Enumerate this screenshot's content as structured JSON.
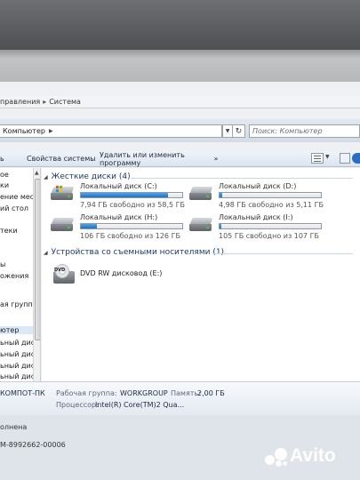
{
  "breadcrumb": {
    "part1": "правления",
    "part2": "Система"
  },
  "address": {
    "path": "Компьютер",
    "search_placeholder": "Поиск: Компьютер"
  },
  "toolbar": {
    "left_fragment": "ь",
    "system_properties": "Свойства системы",
    "uninstall": "Удалить или изменить программу",
    "more": "»"
  },
  "nav": {
    "items": [
      "ое",
      "ки",
      "ение места",
      "ий стол",
      "",
      "теки",
      "",
      "",
      "ы",
      "ожения",
      "",
      "",
      "ая группа",
      "",
      "ютер",
      "ьный диск",
      "ьный диск",
      "ьный диск",
      "ьный диск"
    ]
  },
  "hdd_group": {
    "title": "Жесткие диски (4)"
  },
  "drives": [
    {
      "name": "Локальный диск (C:)",
      "free": "7,94 ГБ свободно из 58,5 ГБ",
      "used_fraction": 0.86
    },
    {
      "name": "Локальный диск (D:)",
      "free": "4,98 ГБ свободно из 5,11 ГБ",
      "used_fraction": 0.03
    },
    {
      "name": "Локальный диск (H:)",
      "free": "106 ГБ свободно из 126 ГБ",
      "used_fraction": 0.16
    },
    {
      "name": "Локальный диск (I:)",
      "free": "105 ГБ свободно из 107 ГБ",
      "used_fraction": 0.02
    }
  ],
  "removable_group": {
    "title": "Устройства со съемными носителями (1)"
  },
  "dvd": {
    "name": "DVD RW дисковод (E:)",
    "badge": "DVD"
  },
  "details": {
    "pc_name": "КОМПОТ-ПК",
    "workgroup_label": "Рабочая группа:",
    "workgroup_value": "WORKGROUP",
    "memory_label": "Память:",
    "memory_value": "2,00 ГБ",
    "cpu_label": "Процессор:",
    "cpu_value": "Intel(R) Core(TM)2 Qua..."
  },
  "status": {
    "activation": "олнена",
    "product_id": "M-8992662-00006"
  },
  "watermark": {
    "brand": "Avito"
  },
  "colors": {
    "bar_fill": "#1d6fc4",
    "group_title": "#1d3a6b",
    "selection": "#dbe8f7"
  }
}
